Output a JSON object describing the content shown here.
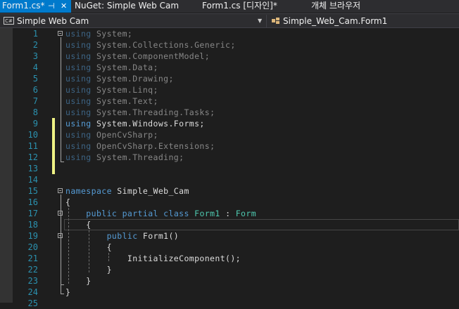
{
  "tabs": [
    {
      "label": "Form1.cs*",
      "pin_icon": "pin",
      "close_icon": "close",
      "active": true
    },
    {
      "label": "NuGet: Simple Web Cam"
    },
    {
      "label": "Form1.cs [디자인]*"
    },
    {
      "label": "개체 브라우저"
    }
  ],
  "nav": {
    "project_icon": "C#",
    "project": "Simple Web Cam",
    "class": "Simple_Web_Cam.Form1"
  },
  "editor": {
    "lines": [
      {
        "n": "1",
        "text": "using System;"
      },
      {
        "n": "2",
        "text": "using System.Collections.Generic;"
      },
      {
        "n": "3",
        "text": "using System.ComponentModel;"
      },
      {
        "n": "4",
        "text": "using System.Data;"
      },
      {
        "n": "5",
        "text": "using System.Drawing;"
      },
      {
        "n": "6",
        "text": "using System.Linq;"
      },
      {
        "n": "7",
        "text": "using System.Text;"
      },
      {
        "n": "8",
        "text": "using System.Threading.Tasks;"
      },
      {
        "n": "9",
        "text": "using System.Windows.Forms;"
      },
      {
        "n": "10",
        "text": "using OpenCvSharp;"
      },
      {
        "n": "11",
        "text": "using OpenCvSharp.Extensions;"
      },
      {
        "n": "12",
        "text": "using System.Threading;"
      },
      {
        "n": "13",
        "text": ""
      },
      {
        "n": "14",
        "text": ""
      },
      {
        "n": "15",
        "text": "namespace Simple_Web_Cam"
      },
      {
        "n": "16",
        "text": "{"
      },
      {
        "n": "17",
        "text": "    public partial class Form1 : Form"
      },
      {
        "n": "18",
        "text": "    {"
      },
      {
        "n": "19",
        "text": "        public Form1()"
      },
      {
        "n": "20",
        "text": "        {"
      },
      {
        "n": "21",
        "text": "            InitializeComponent();"
      },
      {
        "n": "22",
        "text": "        }"
      },
      {
        "n": "23",
        "text": "    }"
      },
      {
        "n": "24",
        "text": "}"
      },
      {
        "n": "25",
        "text": ""
      }
    ]
  },
  "colors": {
    "keyword": "#569cd6",
    "type": "#4ec9b0",
    "text": "#dcdcdc",
    "line_number": "#2b91af",
    "tab_active": "#007acc",
    "change_marker": "#eff284"
  }
}
